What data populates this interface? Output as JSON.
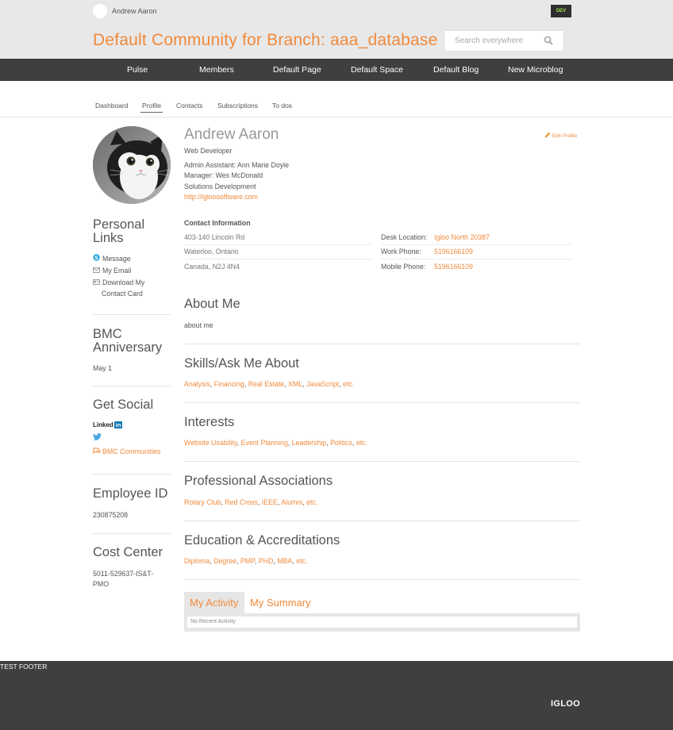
{
  "topbar": {
    "user_name": "Andrew Aaron",
    "env_badge": "DEV"
  },
  "header": {
    "site_title": "Default Community for Branch: aaa_database",
    "search_placeholder": "Search everywhere"
  },
  "nav": {
    "items": [
      "Pulse",
      "Members",
      "Default Page",
      "Default Space",
      "Default Blog",
      "New Microblog"
    ]
  },
  "subtabs": {
    "items": [
      "Dashboard",
      "Profile",
      "Contacts",
      "Subscriptions",
      "To dos"
    ],
    "active": "Profile"
  },
  "profile": {
    "name": "Andrew Aaron",
    "edit_label": "Edit Profile",
    "title": "Web Developer",
    "admin_assistant": "Admin Assistant: Ann Marie Doyle",
    "manager": "Manager: Wes McDonald",
    "department": "Solutions Development",
    "website": "http://igloosoftware.com"
  },
  "contact": {
    "heading": "Contact Information",
    "address_line1": "403-140 Lincoln Rd",
    "address_line2": "Waterloo, Ontario",
    "address_line3": "Canada, N2J 4N4",
    "desk_label": "Desk Location:",
    "desk_value": "Igloo North 20387",
    "work_label": "Work Phone:",
    "work_value": "5196166109",
    "mobile_label": "Mobile Phone:",
    "mobile_value": "5196166109"
  },
  "sidebar": {
    "personal_links_line1": "Personal",
    "personal_links_line2": "Links",
    "message": "Message",
    "email": "My Email",
    "contact_card_line1": "Download My",
    "contact_card_line2": "Contact Card",
    "anniversary_line1": "BMC",
    "anniversary_line2": "Anniversary",
    "anniversary_value": "May 1",
    "social_heading": "Get Social",
    "linkedin_text": "Linked",
    "linkedin_in": "in",
    "communities": "BMC Communities",
    "employee_id_heading": "Employee ID",
    "employee_id_value": "230875208",
    "cost_center_heading": "Cost Center",
    "cost_center_line1": "5011-529637-IS&T-",
    "cost_center_line2": "PMO"
  },
  "sections": {
    "about_title": "About Me",
    "about_text": "about me",
    "skills_title": "Skills/Ask Me About",
    "skills": [
      "Analysis",
      "Financing",
      "Real Estate",
      "XML",
      "JavaScript",
      "etc."
    ],
    "interests_title": "Interests",
    "interests": [
      "Website Usability",
      "Event Planning",
      "Leadership",
      "Politics",
      "etc."
    ],
    "associations_title": "Professional Associations",
    "associations": [
      "Rotary Club",
      "Red Cross",
      "IEEE",
      "Alumni",
      "etc."
    ],
    "education_title": "Education & Accreditations",
    "education": [
      "Diploma",
      "Degree",
      "PMP",
      "PHD",
      "MBA",
      "etc."
    ]
  },
  "activity": {
    "tab1": "My Activity",
    "tab2": "My Summary",
    "empty_text": "No Recent Activity"
  },
  "footer": {
    "text": "TEST FOOTER",
    "logo": "IGLOO"
  },
  "colors": {
    "accent": "#f08a3c",
    "nav_bg": "#3f3f42",
    "header_bg": "#e8e8e8"
  }
}
